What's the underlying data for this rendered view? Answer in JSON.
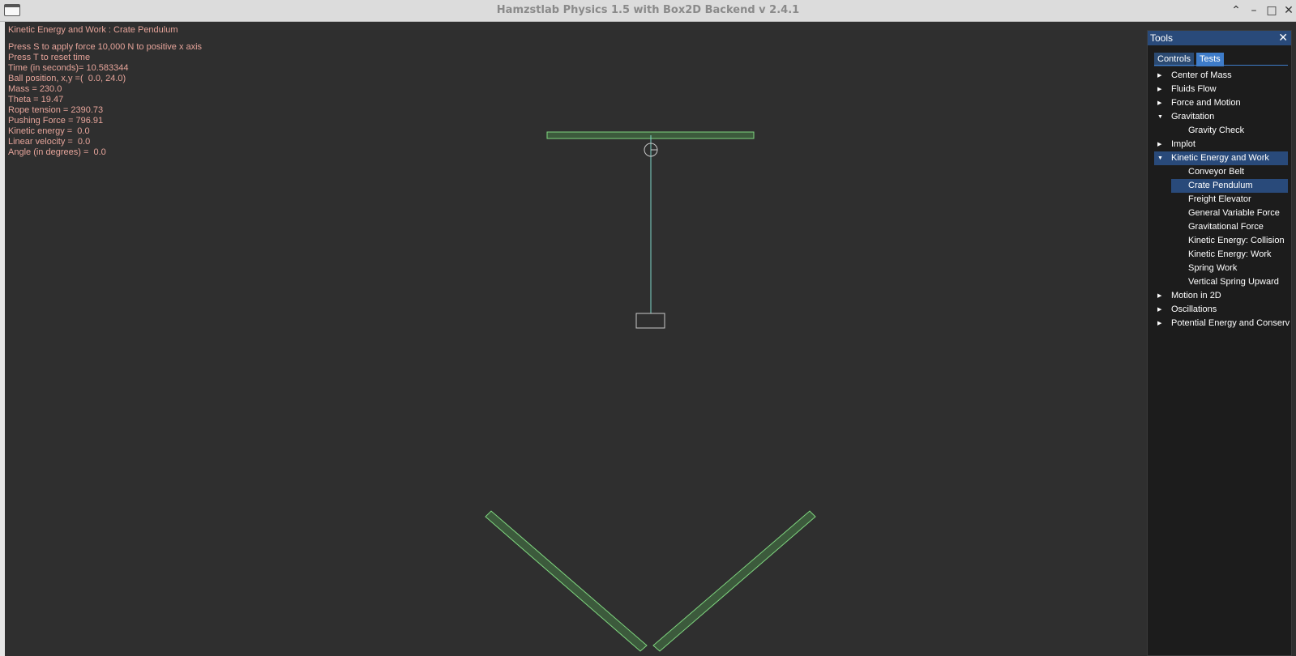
{
  "window": {
    "title": "Hamzstlab Physics 1.5 with Box2D Backend v 2.4.1",
    "controls": {
      "up": "⌃",
      "minimize": "–",
      "maximize": "□",
      "close": "✕"
    }
  },
  "info": {
    "heading": "Kinetic Energy and Work : Crate Pendulum",
    "lines": [
      "Press S to apply force 10,000 N to positive x axis",
      "Press T to reset time",
      "Time (in seconds)= 10.583344",
      "Ball position, x,y =(  0.0, 24.0)",
      "Mass = 230.0",
      "Theta = 19.47",
      "Rope tension = 2390.73",
      "Pushing Force = 796.91",
      "Kinetic energy =  0.0",
      "Linear velocity =  0.0",
      "Angle (in degrees) =  0.0"
    ]
  },
  "tools": {
    "title": "Tools",
    "close": "✕",
    "tabs": [
      {
        "label": "Controls",
        "active": false
      },
      {
        "label": "Tests",
        "active": true
      }
    ],
    "tree": [
      {
        "label": "Center of Mass",
        "expanded": false
      },
      {
        "label": "Fluids Flow",
        "expanded": false
      },
      {
        "label": "Force and Motion",
        "expanded": false
      },
      {
        "label": "Gravitation",
        "expanded": true,
        "children": [
          "Gravity Check"
        ]
      },
      {
        "label": "Implot",
        "expanded": false
      },
      {
        "label": "Kinetic Energy and Work",
        "expanded": true,
        "selected": true,
        "children": [
          "Conveyor Belt",
          "Crate Pendulum",
          "Freight Elevator",
          "General Variable Force",
          "Gravitational Force",
          "Kinetic Energy: Collision",
          "Kinetic Energy: Work",
          "Spring Work",
          "Vertical Spring Upward"
        ],
        "selected_child": "Crate Pendulum"
      },
      {
        "label": "Motion in 2D",
        "expanded": false
      },
      {
        "label": "Oscillations",
        "expanded": false
      },
      {
        "label": "Potential Energy and Conserv",
        "expanded": false
      }
    ]
  },
  "colors": {
    "background": "#2f2f2f",
    "info_text": "#e6a49a",
    "static_body": "#7fd67f",
    "static_fill": "#3c5a3c",
    "rope": "#7fd6c8",
    "crate": "#c8c8c8",
    "selection": "#294a7a",
    "tab_active": "#3e7cc9"
  }
}
